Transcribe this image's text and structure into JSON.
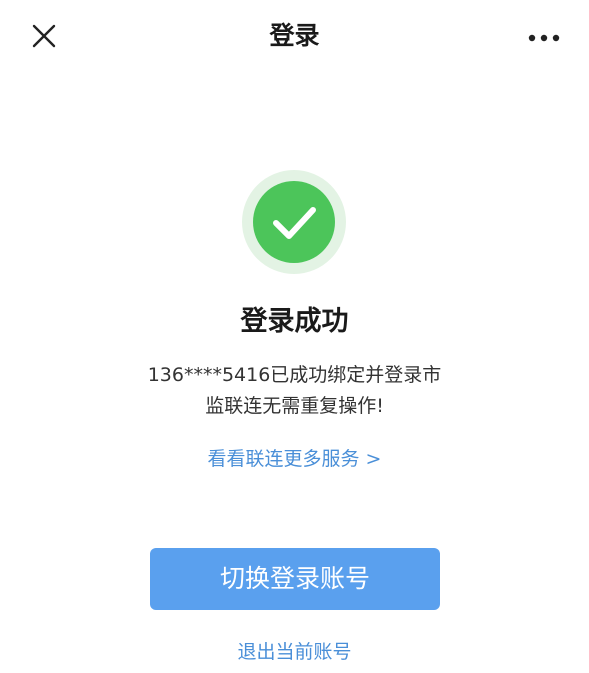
{
  "header": {
    "title": "登录",
    "close_icon": "close-icon",
    "more_icon": "more-icon"
  },
  "result": {
    "icon": "check-circle-icon",
    "title": "登录成功",
    "description_line1": "136****5416已成功绑定并登录市",
    "description_line2": "监联连无需重复操作!"
  },
  "links": {
    "more_services": "看看联连更多服务 >",
    "logout": "退出当前账号"
  },
  "actions": {
    "switch_account": "切换登录账号"
  },
  "colors": {
    "success_green": "#4cc55a",
    "success_ring": "#e3f3e4",
    "link_blue": "#4a8fd8",
    "primary_button": "#5aa0ee",
    "text_dark": "#1a1a1a"
  }
}
